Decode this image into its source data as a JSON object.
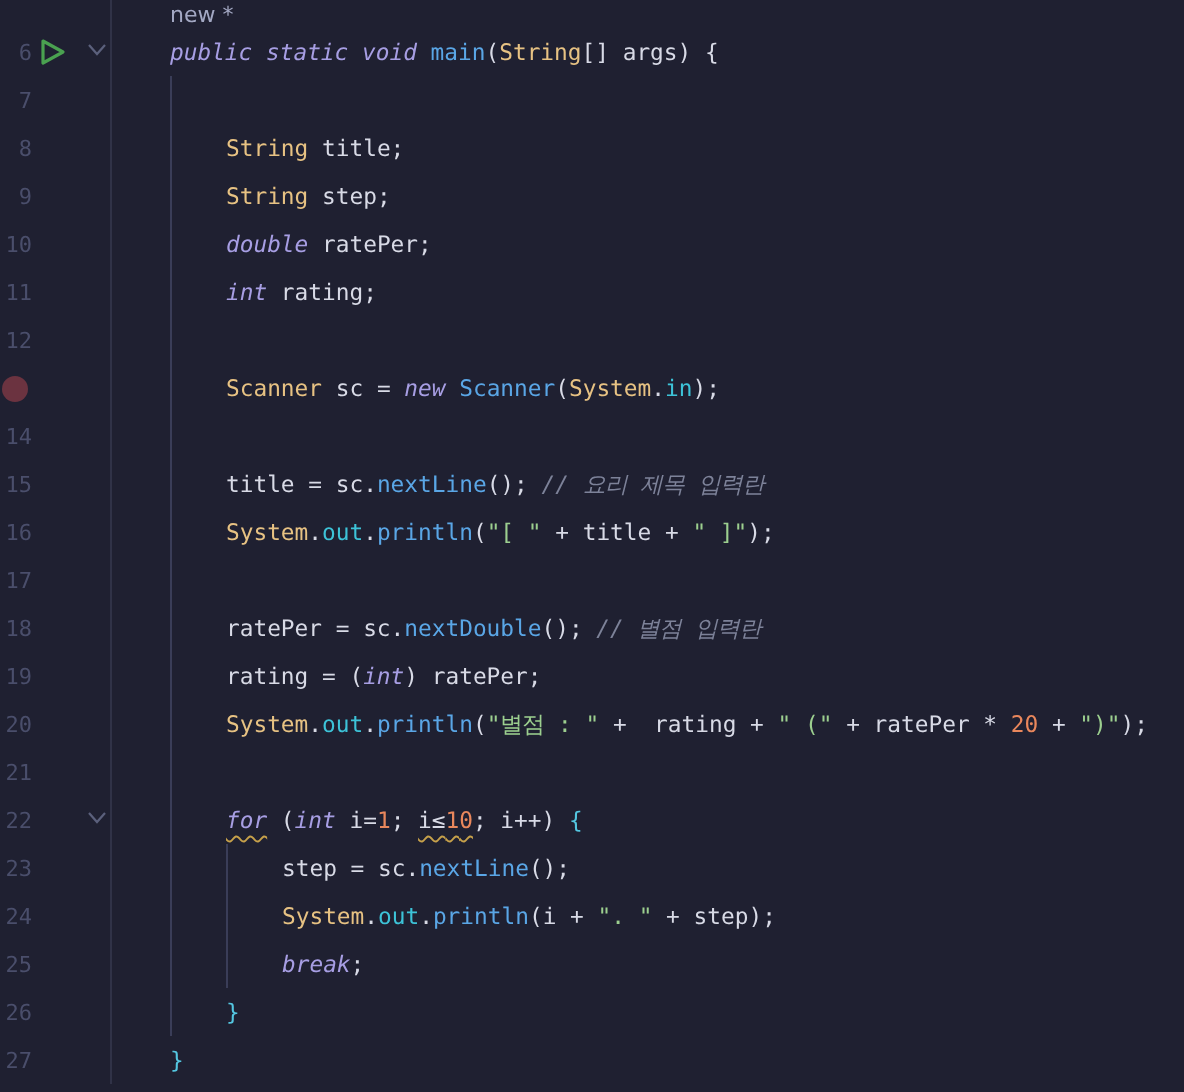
{
  "hint": "new *",
  "lines": [
    {
      "number": "6",
      "run": true,
      "fold": true,
      "breakpoint": false,
      "tokens": [
        {
          "text": "public static void",
          "kind": "keyword"
        },
        {
          "text": " main",
          "kind": "method"
        },
        {
          "text": "(",
          "kind": "plain"
        },
        {
          "text": "String",
          "kind": "type"
        },
        {
          "text": "[] args) {",
          "kind": "plain"
        }
      ],
      "children": [
        {
          "number": "7",
          "run": false,
          "fold": false,
          "breakpoint": false
        },
        {
          "number": "8",
          "run": false,
          "fold": false,
          "breakpoint": false,
          "tokens": [
            {
              "text": "String",
              "kind": "type"
            },
            {
              "text": " title;",
              "kind": "plain"
            }
          ]
        },
        {
          "number": "9",
          "run": false,
          "fold": false,
          "breakpoint": false,
          "tokens": [
            {
              "text": "String",
              "kind": "type"
            },
            {
              "text": " step;",
              "kind": "plain"
            }
          ]
        },
        {
          "number": "10",
          "run": false,
          "fold": false,
          "breakpoint": false,
          "tokens": [
            {
              "text": "double",
              "kind": "keyword"
            },
            {
              "text": " ratePer;",
              "kind": "plain"
            }
          ]
        },
        {
          "number": "11",
          "run": false,
          "fold": false,
          "breakpoint": false,
          "tokens": [
            {
              "text": "int",
              "kind": "keyword"
            },
            {
              "text": " rating;",
              "kind": "plain"
            }
          ]
        },
        {
          "number": "12",
          "run": false,
          "fold": false,
          "breakpoint": false
        },
        {
          "run": false,
          "fold": false,
          "breakpoint": true,
          "tokens": [
            {
              "text": "Scanner",
              "kind": "type"
            },
            {
              "text": " sc = ",
              "kind": "plain"
            },
            {
              "text": "new",
              "kind": "keyword"
            },
            {
              "text": " Scanner",
              "kind": "method"
            },
            {
              "text": "(",
              "kind": "plain"
            },
            {
              "text": "System",
              "kind": "type"
            },
            {
              "text": ".",
              "kind": "plain"
            },
            {
              "text": "in",
              "kind": "field"
            },
            {
              "text": ");",
              "kind": "plain"
            }
          ]
        },
        {
          "number": "14",
          "run": false,
          "fold": false,
          "breakpoint": false
        },
        {
          "number": "15",
          "run": false,
          "fold": false,
          "breakpoint": false,
          "tokens": [
            {
              "text": "title = sc.",
              "kind": "plain"
            },
            {
              "text": "nextLine",
              "kind": "method"
            },
            {
              "text": "(); ",
              "kind": "plain"
            },
            {
              "text": "// 요리 제목 입력란",
              "kind": "comment"
            }
          ]
        },
        {
          "number": "16",
          "run": false,
          "fold": false,
          "breakpoint": false,
          "tokens": [
            {
              "text": "System",
              "kind": "type"
            },
            {
              "text": ".",
              "kind": "plain"
            },
            {
              "text": "out",
              "kind": "field"
            },
            {
              "text": ".",
              "kind": "plain"
            },
            {
              "text": "println",
              "kind": "method"
            },
            {
              "text": "(",
              "kind": "plain"
            },
            {
              "text": "\"[ \"",
              "kind": "string"
            },
            {
              "text": " + title + ",
              "kind": "plain"
            },
            {
              "text": "\" ]\"",
              "kind": "string"
            },
            {
              "text": ");",
              "kind": "plain"
            }
          ]
        },
        {
          "number": "17",
          "run": false,
          "fold": false,
          "breakpoint": false
        },
        {
          "number": "18",
          "run": false,
          "fold": false,
          "breakpoint": false,
          "tokens": [
            {
              "text": "ratePer = sc.",
              "kind": "plain"
            },
            {
              "text": "nextDouble",
              "kind": "method"
            },
            {
              "text": "(); ",
              "kind": "plain"
            },
            {
              "text": "// 별점 입력란",
              "kind": "comment"
            }
          ]
        },
        {
          "number": "19",
          "run": false,
          "fold": false,
          "breakpoint": false,
          "tokens": [
            {
              "text": "rating = (",
              "kind": "plain"
            },
            {
              "text": "int",
              "kind": "keyword"
            },
            {
              "text": ") ratePer;",
              "kind": "plain"
            }
          ]
        },
        {
          "number": "20",
          "run": false,
          "fold": false,
          "breakpoint": false,
          "tokens": [
            {
              "text": "System",
              "kind": "type"
            },
            {
              "text": ".",
              "kind": "plain"
            },
            {
              "text": "out",
              "kind": "field"
            },
            {
              "text": ".",
              "kind": "plain"
            },
            {
              "text": "println",
              "kind": "method"
            },
            {
              "text": "(",
              "kind": "plain"
            },
            {
              "text": "\"별점 : \"",
              "kind": "string"
            },
            {
              "text": " +  rating + ",
              "kind": "plain"
            },
            {
              "text": "\" (\"",
              "kind": "string"
            },
            {
              "text": " + ratePer * ",
              "kind": "plain"
            },
            {
              "text": "20",
              "kind": "number"
            },
            {
              "text": " + ",
              "kind": "plain"
            },
            {
              "text": "\")\"",
              "kind": "string"
            },
            {
              "text": ");",
              "kind": "plain"
            }
          ]
        },
        {
          "number": "21",
          "run": false,
          "fold": false,
          "breakpoint": false
        },
        {
          "number": "22",
          "run": false,
          "fold": true,
          "breakpoint": false,
          "tokens": [
            {
              "text": "for",
              "kind": "keyword",
              "warning": true
            },
            {
              "text": " (",
              "kind": "plain"
            },
            {
              "text": "int",
              "kind": "keyword"
            },
            {
              "text": " i=",
              "kind": "plain"
            },
            {
              "text": "1",
              "kind": "number"
            },
            {
              "text": "; ",
              "kind": "plain"
            },
            {
              "text": "i≤",
              "kind": "plain",
              "warning": true
            },
            {
              "text": "10",
              "kind": "number",
              "warning": true
            },
            {
              "text": "; i++) ",
              "kind": "plain"
            },
            {
              "text": "{",
              "kind": "brace"
            }
          ],
          "children": [
            {
              "number": "23",
              "run": false,
              "fold": false,
              "breakpoint": false,
              "tokens": [
                {
                  "text": "step = sc.",
                  "kind": "plain"
                },
                {
                  "text": "nextLine",
                  "kind": "method"
                },
                {
                  "text": "();",
                  "kind": "plain"
                }
              ]
            },
            {
              "number": "24",
              "run": false,
              "fold": false,
              "breakpoint": false,
              "tokens": [
                {
                  "text": "System",
                  "kind": "type"
                },
                {
                  "text": ".",
                  "kind": "plain"
                },
                {
                  "text": "out",
                  "kind": "field"
                },
                {
                  "text": ".",
                  "kind": "plain"
                },
                {
                  "text": "println",
                  "kind": "method"
                },
                {
                  "text": "(i + ",
                  "kind": "plain"
                },
                {
                  "text": "\". \"",
                  "kind": "string"
                },
                {
                  "text": " + step);",
                  "kind": "plain"
                }
              ]
            },
            {
              "number": "25",
              "run": false,
              "fold": false,
              "breakpoint": false,
              "tokens": [
                {
                  "text": "break",
                  "kind": "keyword"
                },
                {
                  "text": ";",
                  "kind": "plain"
                }
              ]
            }
          ]
        },
        {
          "number": "26",
          "run": false,
          "fold": false,
          "breakpoint": false,
          "tokens": [
            {
              "text": "}",
              "kind": "brace"
            }
          ]
        }
      ]
    },
    {
      "number": "27",
      "run": false,
      "fold": false,
      "breakpoint": false,
      "tokens": [
        {
          "text": "}",
          "kind": "brace"
        }
      ]
    }
  ]
}
